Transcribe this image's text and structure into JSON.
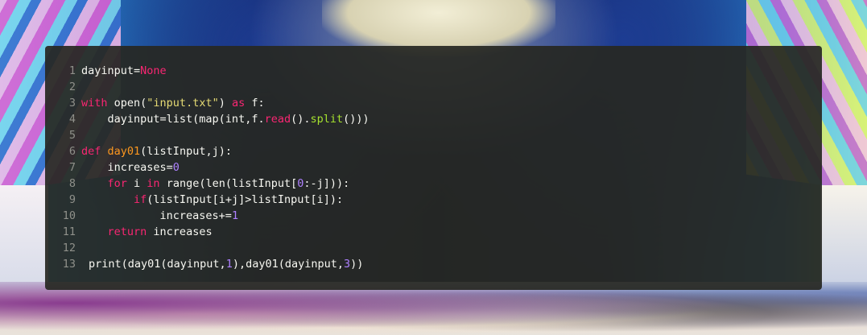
{
  "editor": {
    "lines": [
      {
        "n": "1",
        "segments": [
          {
            "t": "dayinput=",
            "c": "plain"
          },
          {
            "t": "None",
            "c": "kw"
          }
        ]
      },
      {
        "n": "2",
        "segments": []
      },
      {
        "n": "3",
        "segments": [
          {
            "t": "with",
            "c": "kw"
          },
          {
            "t": " open(",
            "c": "plain"
          },
          {
            "t": "\"input.txt\"",
            "c": "str"
          },
          {
            "t": ") ",
            "c": "plain"
          },
          {
            "t": "as",
            "c": "kw"
          },
          {
            "t": " f:",
            "c": "plain"
          }
        ]
      },
      {
        "n": "4",
        "segments": [
          {
            "t": "    dayinput=list(map(int,f.",
            "c": "plain"
          },
          {
            "t": "read",
            "c": "kw"
          },
          {
            "t": "().",
            "c": "plain"
          },
          {
            "t": "split",
            "c": "mth"
          },
          {
            "t": "()))",
            "c": "plain"
          }
        ]
      },
      {
        "n": "5",
        "segments": []
      },
      {
        "n": "6",
        "segments": [
          {
            "t": "def",
            "c": "kw"
          },
          {
            "t": " ",
            "c": "plain"
          },
          {
            "t": "day01",
            "c": "fn"
          },
          {
            "t": "(listInput,j):",
            "c": "plain"
          }
        ]
      },
      {
        "n": "7",
        "segments": [
          {
            "t": "    increases=",
            "c": "plain"
          },
          {
            "t": "0",
            "c": "num"
          }
        ]
      },
      {
        "n": "8",
        "segments": [
          {
            "t": "    ",
            "c": "plain"
          },
          {
            "t": "for",
            "c": "kw"
          },
          {
            "t": " i ",
            "c": "plain"
          },
          {
            "t": "in",
            "c": "kw"
          },
          {
            "t": " range(len(listInput[",
            "c": "plain"
          },
          {
            "t": "0",
            "c": "num"
          },
          {
            "t": ":-j])):",
            "c": "plain"
          }
        ]
      },
      {
        "n": "9",
        "segments": [
          {
            "t": "        ",
            "c": "plain"
          },
          {
            "t": "if",
            "c": "kw"
          },
          {
            "t": "(listInput[i+j]>listInput[i]):",
            "c": "plain"
          }
        ]
      },
      {
        "n": "10",
        "segments": [
          {
            "t": "            increases+=",
            "c": "plain"
          },
          {
            "t": "1",
            "c": "num"
          }
        ]
      },
      {
        "n": "11",
        "segments": [
          {
            "t": "    ",
            "c": "plain"
          },
          {
            "t": "return",
            "c": "kw"
          },
          {
            "t": " increases",
            "c": "plain"
          }
        ]
      },
      {
        "n": "12",
        "segments": []
      },
      {
        "n": "13",
        "shifted": true,
        "segments": [
          {
            "t": "print(day01(dayinput,",
            "c": "plain"
          },
          {
            "t": "1",
            "c": "num"
          },
          {
            "t": "),day01(dayinput,",
            "c": "plain"
          },
          {
            "t": "3",
            "c": "num"
          },
          {
            "t": "))",
            "c": "plain"
          }
        ]
      }
    ]
  },
  "colors": {
    "panel_background": "#272822",
    "line_number": "#8f908a",
    "plain": "#f8f8f2",
    "keyword": "#f92672",
    "function": "#fd971f",
    "string": "#e6db74",
    "number": "#ae81ff",
    "method": "#a6e22e"
  }
}
